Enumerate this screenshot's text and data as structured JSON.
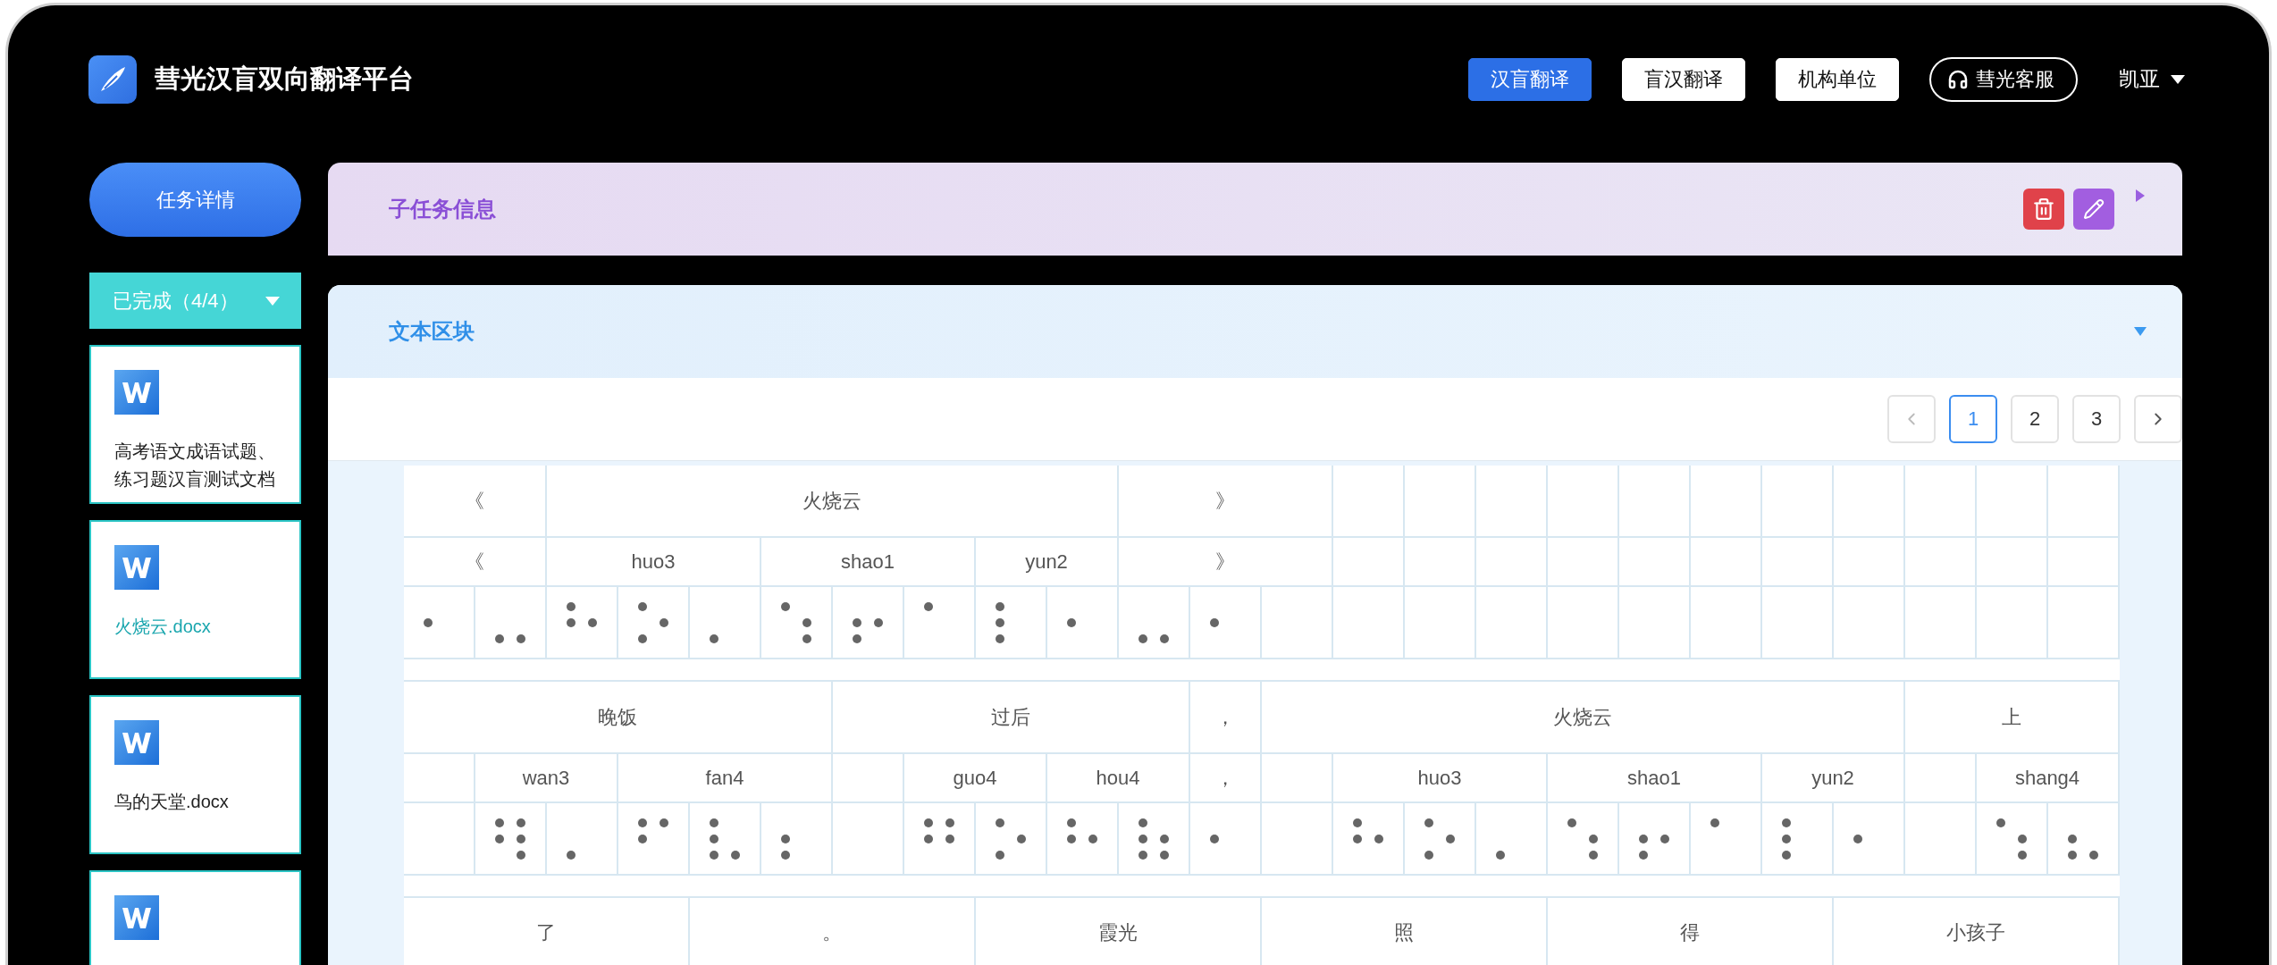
{
  "app": {
    "title": "彗光汉盲双向翻译平台"
  },
  "nav": [
    {
      "label": "汉盲翻译",
      "selected": true
    },
    {
      "label": "盲汉翻译",
      "selected": false
    },
    {
      "label": "机构单位",
      "selected": false
    }
  ],
  "service_button": {
    "label": "彗光客服"
  },
  "user": {
    "name": "凯亚"
  },
  "sidebar": {
    "task_button": "任务详情",
    "status_dropdown": "已完成（4/4）",
    "files": [
      {
        "kind": "word",
        "name": "高考语文成语试题、练习题汉盲测试文档",
        "selected": false
      },
      {
        "kind": "word",
        "name": "火烧云.docx",
        "selected": true
      },
      {
        "kind": "word",
        "name": "鸟的天堂.docx",
        "selected": false
      },
      {
        "kind": "word"
      }
    ]
  },
  "subtask_panel": {
    "title": "子任务信息",
    "expanded": false
  },
  "text_panel": {
    "title": "文本区块",
    "expanded": true,
    "pages": [
      {
        "label": "1",
        "selected": true
      },
      {
        "label": "2",
        "selected": false
      },
      {
        "label": "3",
        "selected": false
      }
    ],
    "groups": [
      {
        "words": [
          {
            "hanzi": "《",
            "syllables": [
              {
                "pinyin": "《",
                "cells": [
                  [
                    false,
                    true,
                    false,
                    false,
                    false,
                    false
                  ],
                  [
                    false,
                    false,
                    true,
                    false,
                    false,
                    true
                  ]
                ]
              }
            ]
          },
          {
            "hanzi": "火烧云",
            "syllables": [
              {
                "pinyin": "huo3",
                "cells": [
                  [
                    true,
                    true,
                    false,
                    false,
                    true,
                    false
                  ],
                  [
                    true,
                    false,
                    true,
                    false,
                    true,
                    false
                  ],
                  [
                    false,
                    false,
                    true,
                    false,
                    false,
                    false
                  ]
                ]
              },
              {
                "pinyin": "shao1",
                "cells": [
                  [
                    true,
                    false,
                    false,
                    false,
                    true,
                    true
                  ],
                  [
                    false,
                    true,
                    true,
                    false,
                    true,
                    false
                  ],
                  [
                    true,
                    false,
                    false,
                    false,
                    false,
                    false
                  ]
                ]
              },
              {
                "pinyin": "yun2",
                "cells": [
                  [
                    true,
                    true,
                    true,
                    false,
                    false,
                    false
                  ],
                  [
                    false,
                    true,
                    false,
                    false,
                    false,
                    false
                  ]
                ]
              }
            ]
          },
          {
            "hanzi": "》",
            "syllables": [
              {
                "pinyin": "》",
                "cells": [
                  [
                    false,
                    false,
                    true,
                    false,
                    false,
                    true
                  ],
                  [
                    false,
                    true,
                    false,
                    false,
                    false,
                    false
                  ],
                  [
                    false,
                    false,
                    false,
                    false,
                    false,
                    false
                  ]
                ]
              }
            ]
          }
        ]
      },
      {
        "words": [
          {
            "hanzi": "晚饭",
            "syllables": [
              {
                "cells": [
                  [
                    false,
                    false,
                    false,
                    false,
                    false,
                    false
                  ]
                ]
              },
              {
                "pinyin": "wan3",
                "cells": [
                  [
                    true,
                    true,
                    false,
                    true,
                    true,
                    true
                  ],
                  [
                    false,
                    false,
                    true,
                    false,
                    false,
                    false
                  ]
                ]
              },
              {
                "pinyin": "fan4",
                "cells": [
                  [
                    true,
                    true,
                    false,
                    true,
                    false,
                    false
                  ],
                  [
                    true,
                    true,
                    true,
                    false,
                    false,
                    true
                  ],
                  [
                    false,
                    true,
                    true,
                    false,
                    false,
                    false
                  ]
                ]
              }
            ]
          },
          {
            "hanzi": "过后",
            "syllables": [
              {
                "cells": [
                  [
                    false,
                    false,
                    false,
                    false,
                    false,
                    false
                  ]
                ]
              },
              {
                "pinyin": "guo4",
                "cells": [
                  [
                    true,
                    true,
                    false,
                    true,
                    true,
                    false
                  ],
                  [
                    true,
                    false,
                    true,
                    false,
                    true,
                    false
                  ]
                ]
              },
              {
                "pinyin": "hou4",
                "cells": [
                  [
                    true,
                    true,
                    false,
                    false,
                    true,
                    false
                  ],
                  [
                    true,
                    true,
                    true,
                    false,
                    true,
                    true
                  ]
                ]
              }
            ]
          },
          {
            "hanzi": "，",
            "syllables": [
              {
                "pinyin": "，",
                "cells": [
                  [
                    false,
                    true,
                    false,
                    false,
                    false,
                    false
                  ]
                ]
              }
            ]
          },
          {
            "hanzi": "火烧云",
            "syllables": [
              {
                "cells": [
                  [
                    false,
                    false,
                    false,
                    false,
                    false,
                    false
                  ]
                ]
              },
              {
                "pinyin": "huo3",
                "cells": [
                  [
                    true,
                    true,
                    false,
                    false,
                    true,
                    false
                  ],
                  [
                    true,
                    false,
                    true,
                    false,
                    true,
                    false
                  ],
                  [
                    false,
                    false,
                    true,
                    false,
                    false,
                    false
                  ]
                ]
              },
              {
                "pinyin": "shao1",
                "cells": [
                  [
                    true,
                    false,
                    false,
                    false,
                    true,
                    true
                  ],
                  [
                    false,
                    true,
                    true,
                    false,
                    true,
                    false
                  ],
                  [
                    true,
                    false,
                    false,
                    false,
                    false,
                    false
                  ]
                ]
              },
              {
                "pinyin": "yun2",
                "cells": [
                  [
                    true,
                    true,
                    true,
                    false,
                    false,
                    false
                  ],
                  [
                    false,
                    true,
                    false,
                    false,
                    false,
                    false
                  ]
                ]
              }
            ]
          },
          {
            "hanzi": "上",
            "syllables": [
              {
                "cells": [
                  [
                    false,
                    false,
                    false,
                    false,
                    false,
                    false
                  ]
                ]
              },
              {
                "pinyin": "shang4",
                "cells": [
                  [
                    true,
                    false,
                    false,
                    false,
                    true,
                    true
                  ],
                  [
                    false,
                    true,
                    true,
                    false,
                    false,
                    true
                  ]
                ]
              }
            ]
          }
        ]
      },
      {
        "words": [
          {
            "hanzi": "了"
          },
          {
            "hanzi": "。"
          },
          {
            "hanzi": "霞光"
          },
          {
            "hanzi": "照"
          },
          {
            "hanzi": "得"
          },
          {
            "hanzi": "小孩子"
          }
        ]
      }
    ]
  }
}
